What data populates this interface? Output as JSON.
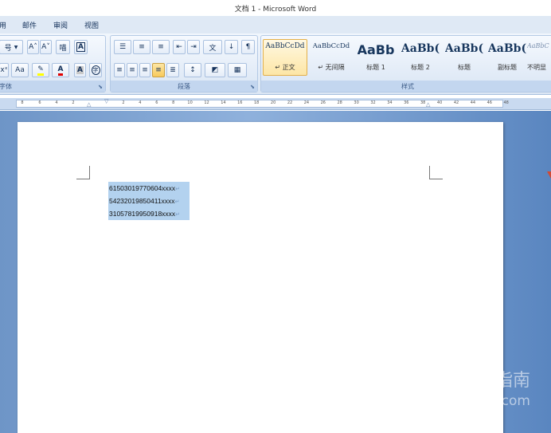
{
  "window": {
    "title": "文档 1 - Microsoft Word"
  },
  "menu": {
    "items": [
      "用",
      "邮件",
      "审阅",
      "视图"
    ]
  },
  "ribbon": {
    "font_group": {
      "label": "字体",
      "size_field": "号",
      "grow_font": "A˄",
      "shrink_font": "A˅",
      "phonetic": "喵",
      "char_border": "A",
      "superscript": "xˣ",
      "change_case": "Aa",
      "highlight": "✎",
      "font_color": "A",
      "char_shading": "A",
      "enclose_char": "字"
    },
    "paragraph_group": {
      "label": "段落",
      "bullets": "☰",
      "numbering": "≡",
      "multilevel": "≡",
      "decrease_indent": "⇤",
      "increase_indent": "⇥",
      "chinese_layout": "文",
      "sort": "↓",
      "show_marks": "¶",
      "align_left": "≡",
      "align_center": "≡",
      "align_right": "≡",
      "justify": "≡",
      "distributed": "≣",
      "line_spacing": "↕",
      "shading": "◩",
      "borders": "▦"
    },
    "styles_group": {
      "label": "样式",
      "styles": [
        {
          "preview": "AaBbCcDd",
          "name": "↵ 正文",
          "selected": true
        },
        {
          "preview": "AaBbCcDd",
          "name": "↵ 无间隔",
          "selected": false
        },
        {
          "preview": "AaBb",
          "name": "标题 1",
          "selected": false
        },
        {
          "preview": "AaBb(",
          "name": "标题 2",
          "selected": false
        },
        {
          "preview": "AaBb(",
          "name": "标题",
          "selected": false
        },
        {
          "preview": "AaBb(",
          "name": "副标题",
          "selected": false
        },
        {
          "preview": "AaBbC",
          "name": "不明显",
          "selected": false
        }
      ]
    }
  },
  "ruler": {
    "left_numbers": [
      "8",
      "6",
      "4",
      "2"
    ],
    "right_numbers": [
      "2",
      "4",
      "6",
      "8",
      "10",
      "12",
      "14",
      "16",
      "18",
      "20",
      "22",
      "24",
      "26",
      "28",
      "30",
      "32",
      "34",
      "36",
      "38",
      "40",
      "42",
      "44",
      "46",
      "48"
    ]
  },
  "document": {
    "lines": [
      "61503019770604xxxx",
      "54232019850411xxxx",
      "31057819950918xxxx"
    ],
    "paragraph_mark": "↵"
  },
  "watermark": {
    "main": "搜狗指南",
    "sub": "zhinan.sogou.com",
    "logo": "S"
  }
}
